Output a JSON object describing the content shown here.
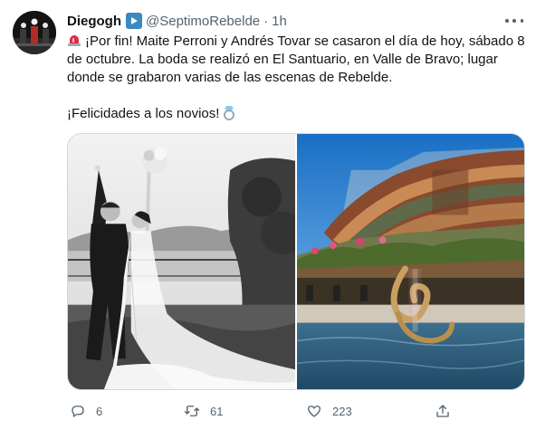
{
  "tweet": {
    "display_name": "Diegogh",
    "handle": "@SeptimoRebelde",
    "dot": "·",
    "time": "1h",
    "text_line1": "¡Por fin! Maite Perroni y Andrés Tovar se casaron el día de hoy, sábado 8 de octubre. La boda se realizó en El Santuario, en Valle de Bravo; lugar donde se grabaron varias de las escenas de Rebelde.",
    "text_line2": "¡Felicidades a los novios!",
    "emoji_start": "rotating-light-icon",
    "emoji_end": "ring-icon",
    "name_emoji": "play-button-icon"
  },
  "media": [
    {
      "icon": "wedding-couple-photo"
    },
    {
      "icon": "el-santuario-hotel-photo"
    }
  ],
  "actions": {
    "reply_count": "6",
    "retweet_count": "61",
    "like_count": "223"
  },
  "colors": {
    "text": "#0f1419",
    "secondary": "#536471",
    "border": "#cfd9de",
    "emoji_blue": "#3b88c3"
  }
}
